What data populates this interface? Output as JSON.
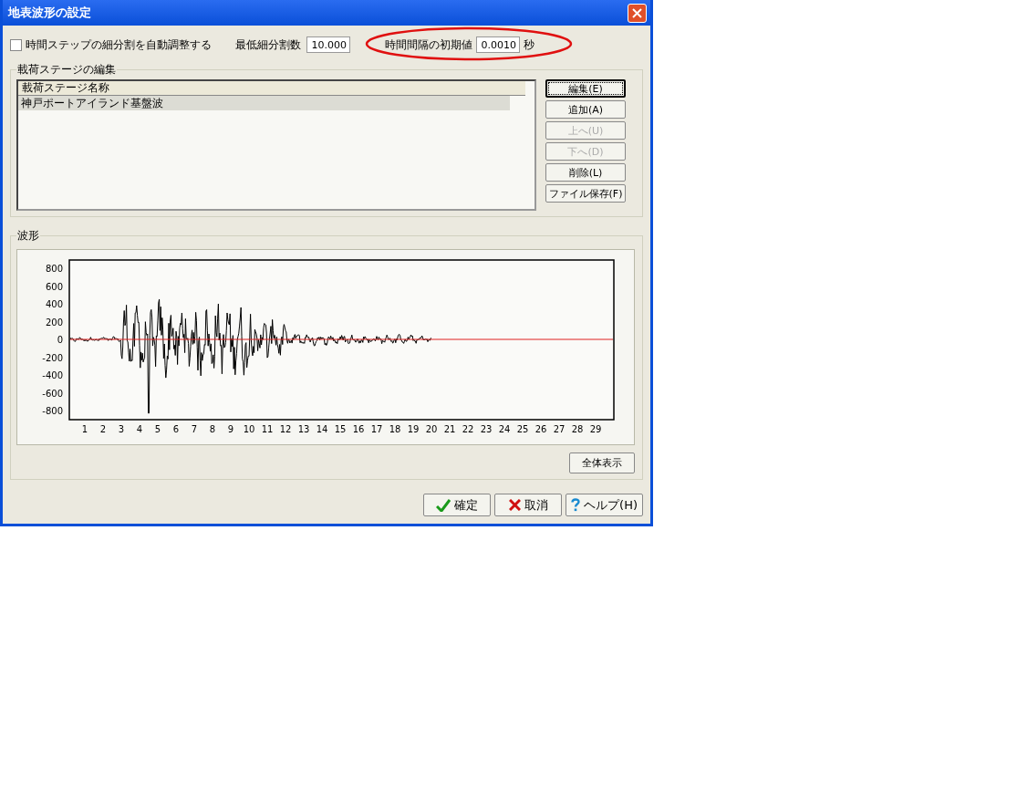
{
  "window": {
    "title": "地表波形の設定"
  },
  "options": {
    "auto_adjust": {
      "label": "時間ステップの細分割を自動調整する",
      "checked": false
    },
    "min_subdivisions": {
      "label": "最低細分割数",
      "value": "10.000"
    },
    "initial_interval": {
      "label": "時間間隔の初期値",
      "value": "0.0010",
      "unit": "秒"
    }
  },
  "stage_editor": {
    "title": "載荷ステージの編集",
    "columns": [
      "載荷ステージ名称"
    ],
    "rows": [
      {
        "name": "神戸ポートアイランド基盤波",
        "selected": true
      }
    ],
    "buttons": [
      {
        "label": "編集(E)",
        "disabled": false,
        "focused": true
      },
      {
        "label": "追加(A)",
        "disabled": false,
        "focused": false
      },
      {
        "label": "上へ(U)",
        "disabled": true,
        "focused": false
      },
      {
        "label": "下へ(D)",
        "disabled": true,
        "focused": false
      },
      {
        "label": "削除(L)",
        "disabled": false,
        "focused": false
      },
      {
        "label": "ファイル保存(F)",
        "disabled": false,
        "focused": false
      }
    ]
  },
  "waveform": {
    "title": "波形",
    "y_ticks": [
      "800",
      "600",
      "400",
      "200",
      "0",
      "-200",
      "-400",
      "-600",
      "-800"
    ],
    "x_ticks": [
      "1",
      "2",
      "3",
      "4",
      "5",
      "6",
      "7",
      "8",
      "9",
      "10",
      "11",
      "12",
      "13",
      "14",
      "15",
      "16",
      "17",
      "18",
      "19",
      "20",
      "21",
      "22",
      "23",
      "24",
      "25",
      "26",
      "27",
      "28",
      "29"
    ],
    "fit_button": "全体表示"
  },
  "footer_buttons": [
    {
      "label": "確定",
      "kind": "ok"
    },
    {
      "label": "取消",
      "kind": "cancel"
    },
    {
      "label": "ヘルプ(H)",
      "kind": "help"
    }
  ]
}
